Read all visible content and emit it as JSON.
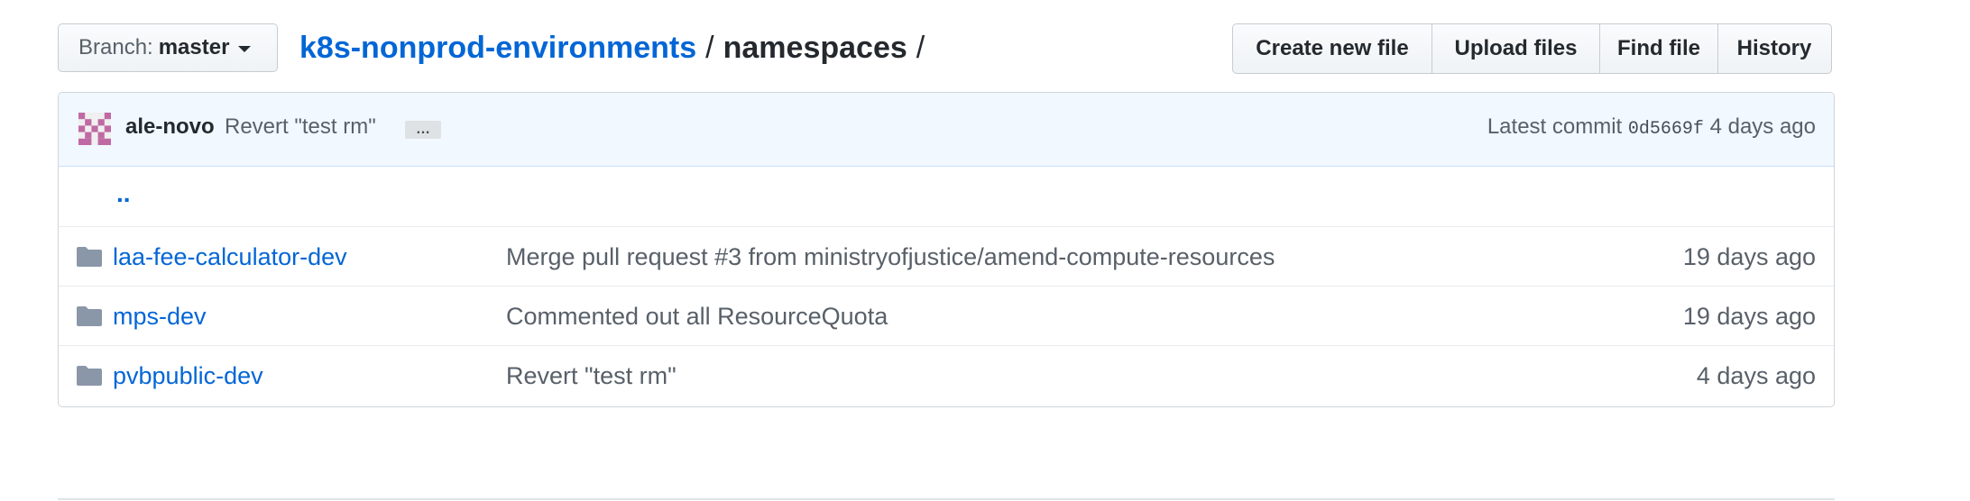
{
  "branch": {
    "prefix": "Branch:",
    "name": "master"
  },
  "breadcrumb": {
    "repo": "k8s-nonprod-environments",
    "separator": "/",
    "current": "namespaces",
    "trailing": "/"
  },
  "actions": [
    "Create new file",
    "Upload files",
    "Find file",
    "History"
  ],
  "commit": {
    "author": "ale-novo",
    "message": "Revert \"test rm\"",
    "ellipsis": "…",
    "latest_label": "Latest commit",
    "sha": "0d5669f",
    "age": "4 days ago"
  },
  "parent_dir": "..",
  "files": [
    {
      "name": "laa-fee-calculator-dev",
      "message": "Merge pull request #3 from ministryofjustice/amend-compute-resources",
      "age": "19 days ago",
      "icon": "folder-icon"
    },
    {
      "name": "mps-dev",
      "message": "Commented out all ResourceQuota",
      "age": "19 days ago",
      "icon": "folder-icon"
    },
    {
      "name": "pvbpublic-dev",
      "message": "Revert \"test rm\"",
      "age": "4 days ago",
      "icon": "folder-icon"
    }
  ],
  "colors": {
    "link": "#0366d6",
    "folder": "#79b8ff",
    "commit_bg": "#f1f8ff"
  }
}
